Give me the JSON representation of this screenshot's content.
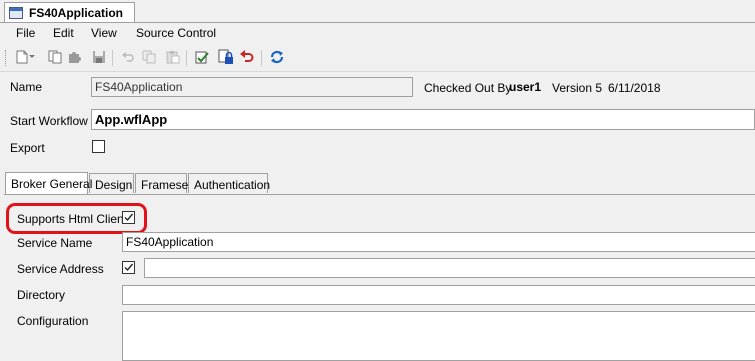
{
  "document_tab": {
    "title": "FS40Application",
    "icon": "application-window-icon"
  },
  "menu": [
    "File",
    "Edit",
    "View",
    "Source Control"
  ],
  "toolbar_icons": [
    "new-document-icon",
    "dropdown-arrow-icon",
    "copy-document-icon",
    "puzzle-piece-icon",
    "save-icon",
    "undo-icon",
    "copy-icon",
    "paste-icon",
    "check-in-icon",
    "check-out-lock-icon",
    "undo-checkout-icon",
    "refresh-sync-icon"
  ],
  "form": {
    "name_label": "Name",
    "name_value": "FS40Application",
    "checked_out_by_label": "Checked Out By",
    "checked_out_by_user": "user1",
    "version_text": "Version 5",
    "date": "6/11/2018",
    "start_workflow_label": "Start Workflow",
    "start_workflow_value": "App.wflApp",
    "export_label": "Export",
    "export_checked": false
  },
  "tabs": [
    "Broker General",
    "Design",
    "Frameset",
    "Authentication"
  ],
  "active_tab": "Broker General",
  "broker_general": {
    "supports_html_client_label": "Supports Html Client",
    "supports_html_client_checked": true,
    "service_name_label": "Service Name",
    "service_name_value": "FS40Application",
    "service_address_label": "Service Address",
    "service_address_checked": true,
    "service_address_value": "",
    "directory_label": "Directory",
    "directory_value": "",
    "configuration_label": "Configuration",
    "configuration_value": ""
  },
  "colors": {
    "highlight": "#e0121a",
    "window_bg": "#f0f0f0",
    "field_bg": "#ffffff"
  }
}
